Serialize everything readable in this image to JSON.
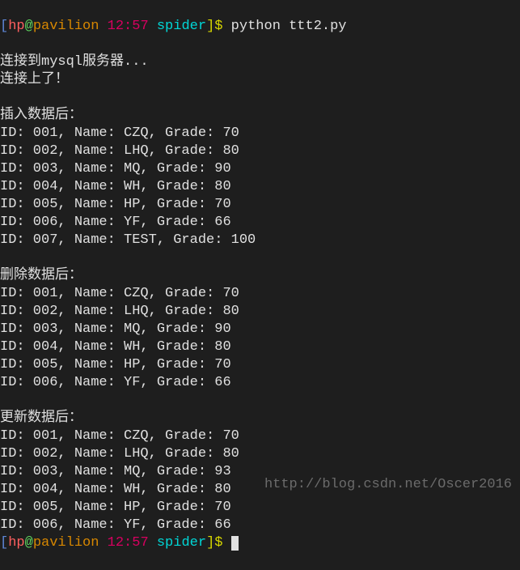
{
  "prompt1": {
    "bracket_open": "[",
    "user": "hp",
    "at": "@",
    "host": "pavilion",
    "time": "12:57",
    "dir": "spider",
    "bracket_close": "]",
    "dollar": "$",
    "command": " python ttt2.py"
  },
  "output": {
    "connecting": "连接到mysql服务器...",
    "connected": "连接上了！",
    "blank1": "",
    "insert_header": "插入数据后：",
    "rows_insert": [
      "ID: 001, Name: CZQ, Grade: 70",
      "ID: 002, Name: LHQ, Grade: 80",
      "ID: 003, Name: MQ, Grade: 90",
      "ID: 004, Name: WH, Grade: 80",
      "ID: 005, Name: HP, Grade: 70",
      "ID: 006, Name: YF, Grade: 66",
      "ID: 007, Name: TEST, Grade: 100"
    ],
    "blank2": "",
    "delete_header": "删除数据后：",
    "rows_delete": [
      "ID: 001, Name: CZQ, Grade: 70",
      "ID: 002, Name: LHQ, Grade: 80",
      "ID: 003, Name: MQ, Grade: 90",
      "ID: 004, Name: WH, Grade: 80",
      "ID: 005, Name: HP, Grade: 70",
      "ID: 006, Name: YF, Grade: 66"
    ],
    "blank3": "",
    "update_header": "更新数据后：",
    "rows_update": [
      "ID: 001, Name: CZQ, Grade: 70",
      "ID: 002, Name: LHQ, Grade: 80",
      "ID: 003, Name: MQ, Grade: 93",
      "ID: 004, Name: WH, Grade: 80",
      "ID: 005, Name: HP, Grade: 70",
      "ID: 006, Name: YF, Grade: 66"
    ]
  },
  "prompt2": {
    "bracket_open": "[",
    "user": "hp",
    "at": "@",
    "host": "pavilion",
    "time": "12:57",
    "dir": "spider",
    "bracket_close": "]",
    "dollar": "$"
  },
  "watermark": "http://blog.csdn.net/Oscer2016"
}
